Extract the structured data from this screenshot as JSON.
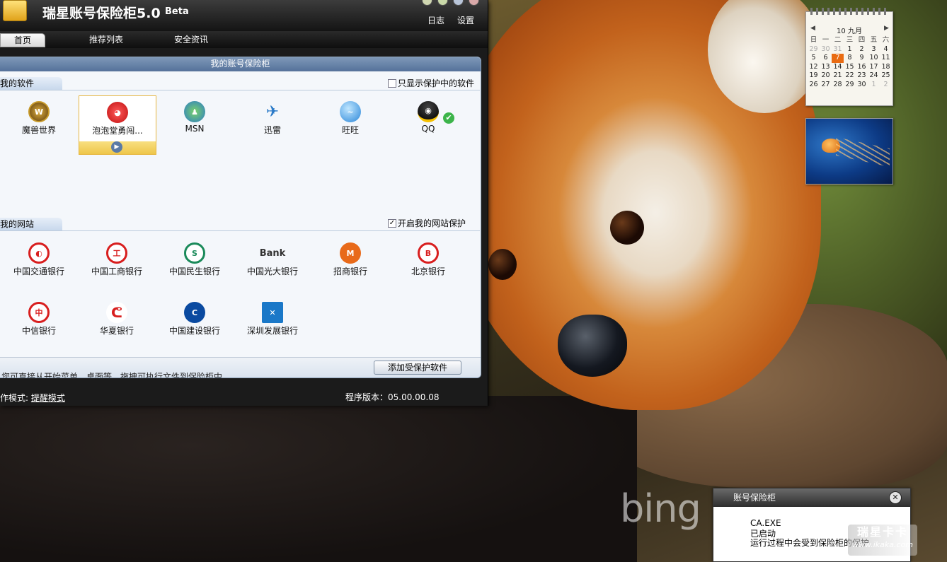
{
  "app": {
    "title": "瑞星账号保险柜5.0",
    "beta": "Beta",
    "top_links": [
      "日志",
      "设置"
    ]
  },
  "tabs": [
    {
      "label": "首页",
      "active": true
    },
    {
      "label": "推荐列表",
      "active": false
    },
    {
      "label": "安全资讯",
      "active": false
    }
  ],
  "content": {
    "header": "我的账号保险柜",
    "software": {
      "section": "我的软件",
      "filter_label": "只显示保护中的软件",
      "filter_checked": false,
      "items": [
        {
          "label": "魔兽世界",
          "icon": "warcraft-icon"
        },
        {
          "label": "泡泡堂勇闯...",
          "icon": "bubble-game-icon",
          "selected": true
        },
        {
          "label": "MSN",
          "icon": "msn-icon"
        },
        {
          "label": "迅雷",
          "icon": "thunder-icon"
        },
        {
          "label": "旺旺",
          "icon": "wangwang-icon"
        },
        {
          "label": "QQ",
          "icon": "qq-icon",
          "protected": true
        }
      ]
    },
    "sites": {
      "section": "我的网站",
      "protect_label": "开启我的网站保护",
      "protect_checked": true,
      "items": [
        {
          "label": "中国交通银行",
          "icon": "bocom-icon"
        },
        {
          "label": "中国工商银行",
          "icon": "icbc-icon"
        },
        {
          "label": "中国民生银行",
          "icon": "cmbc-icon"
        },
        {
          "label": "中国光大银行",
          "icon": "ceb-icon",
          "text": "Bank"
        },
        {
          "label": "招商银行",
          "icon": "cmb-icon"
        },
        {
          "label": "北京银行",
          "icon": "bob-icon"
        },
        {
          "label": "中信银行",
          "icon": "citic-icon"
        },
        {
          "label": "华夏银行",
          "icon": "hxb-icon"
        },
        {
          "label": "中国建设银行",
          "icon": "ccb-icon"
        },
        {
          "label": "深圳发展银行",
          "icon": "sdb-icon"
        }
      ]
    },
    "add_button": "添加受保护软件",
    "hint": "您可直接从开始菜单，桌面等，拖拽可执行文件到保险柜中"
  },
  "status": {
    "mode_label": "作模式:",
    "mode_value": "提醒模式",
    "version": "程序版本：05.00.00.08"
  },
  "calendar": {
    "header": "10 九月",
    "weekdays": [
      "日",
      "一",
      "二",
      "三",
      "四",
      "五",
      "六"
    ],
    "weeks": [
      [
        "29",
        "30",
        "31",
        "1",
        "2",
        "3",
        "4"
      ],
      [
        "5",
        "6",
        "7",
        "8",
        "9",
        "10",
        "11"
      ],
      [
        "12",
        "13",
        "14",
        "15",
        "16",
        "17",
        "18"
      ],
      [
        "19",
        "20",
        "21",
        "22",
        "23",
        "24",
        "25"
      ],
      [
        "26",
        "27",
        "28",
        "29",
        "30",
        "1",
        "2"
      ]
    ],
    "today": "7"
  },
  "notification": {
    "title": "账号保险柜",
    "lines": [
      "CA.EXE",
      "已启动",
      "运行过程中会受到保险柜的保护"
    ]
  },
  "watermark": {
    "brand": "瑞星卡卡",
    "url": "www.ikaka.com"
  },
  "wallpaper_logo": "bing",
  "colors": {
    "accent": "#e96b12",
    "header": "#55719a",
    "selected": "#eec64a"
  }
}
